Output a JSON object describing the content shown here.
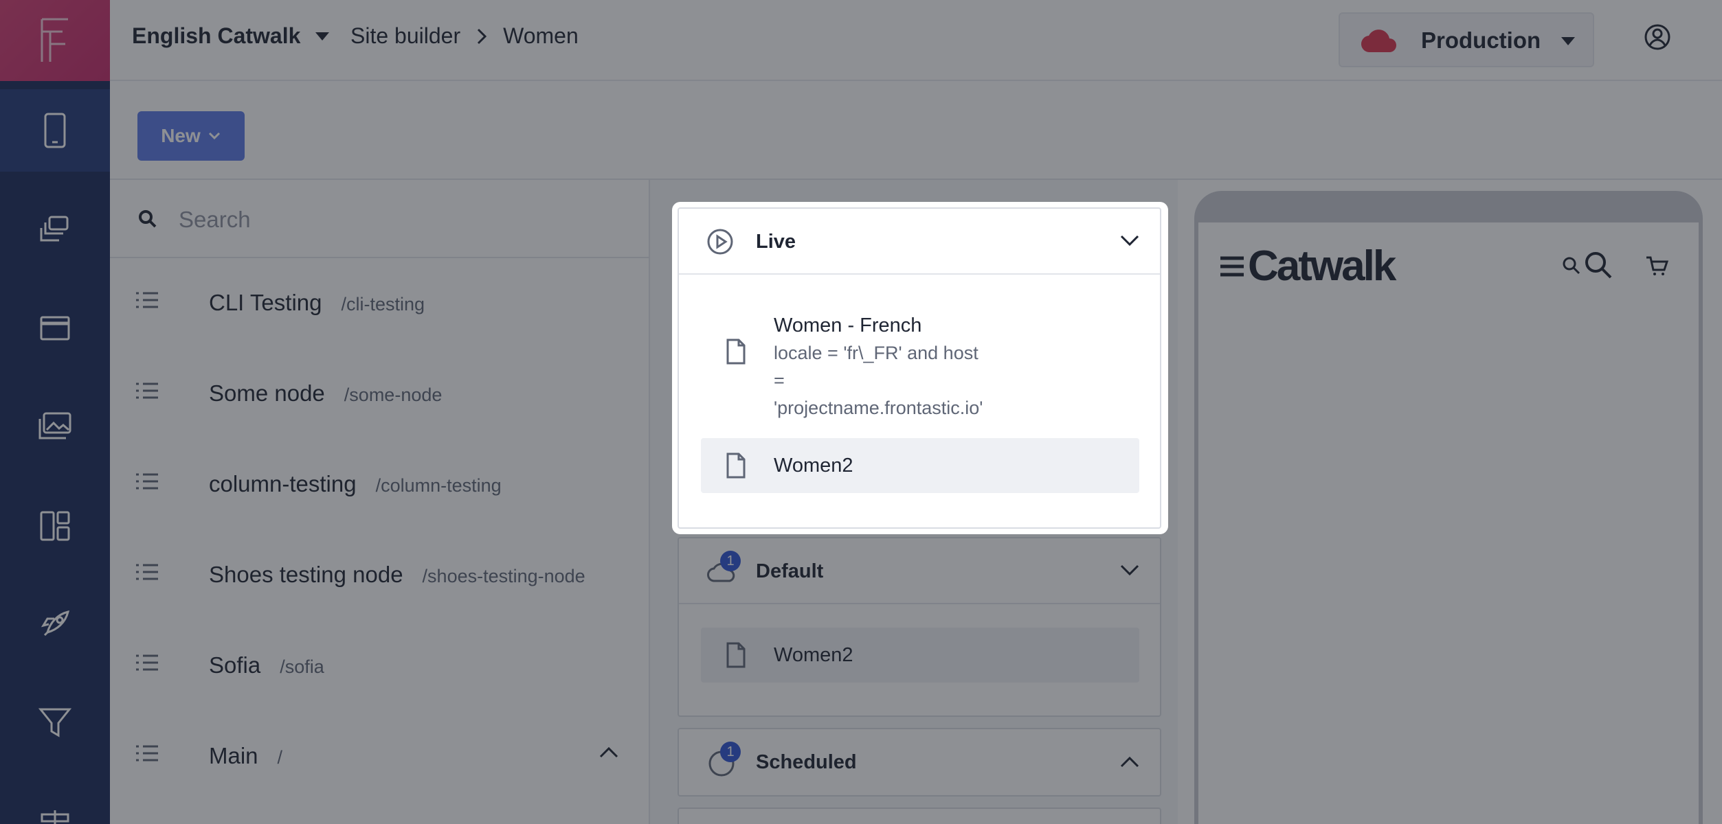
{
  "header": {
    "project_name": "English Catwalk",
    "breadcrumb": [
      "Site builder",
      "Women"
    ],
    "environment": "Production"
  },
  "toolbar": {
    "new_label": "New"
  },
  "search": {
    "placeholder": "Search"
  },
  "tree": {
    "nodes": [
      {
        "name": "CLI Testing",
        "path": "/cli-testing"
      },
      {
        "name": "Some node",
        "path": "/some-node"
      },
      {
        "name": "column-testing",
        "path": "/column-testing"
      },
      {
        "name": "Shoes testing node",
        "path": "/shoes-testing-node"
      },
      {
        "name": "Sofia",
        "path": "/sofia"
      },
      {
        "name": "Main",
        "path": "/"
      }
    ]
  },
  "sections": {
    "live": {
      "title": "Live",
      "pages": [
        {
          "title": "Women - French",
          "condition_lines": [
            "locale = 'fr\\_FR' and host",
            "=",
            "'projectname.frontastic.io'"
          ]
        },
        {
          "title": "Women2"
        }
      ]
    },
    "default": {
      "title": "Default",
      "count": "1",
      "pages": [
        {
          "title": "Women2"
        }
      ]
    },
    "scheduled": {
      "title": "Scheduled",
      "count": "1"
    }
  },
  "preview": {
    "brand": "Catwalk"
  },
  "icons": {
    "rail": [
      "frontastic-logo-icon",
      "mobile-icon",
      "stack-icon",
      "browser-window-icon",
      "images-icon",
      "layout-icon",
      "rocket-icon",
      "filter-icon",
      "signpost-icon"
    ],
    "accent": "#2f55d4",
    "new_button": "#5a79e5",
    "rail_background": "#1a2a5b"
  }
}
